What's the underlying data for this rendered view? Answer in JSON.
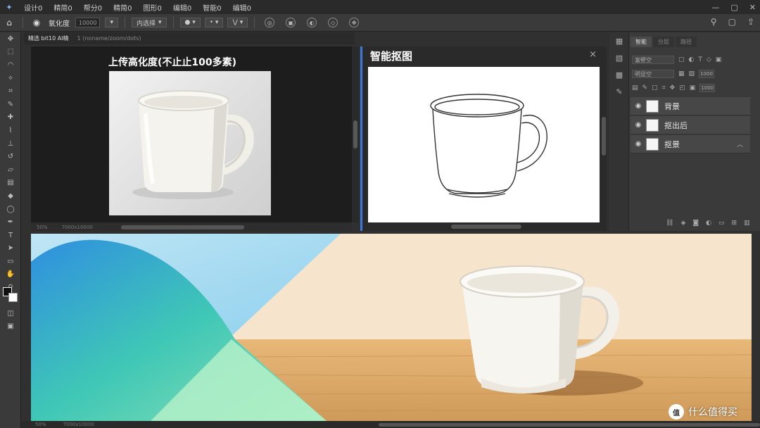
{
  "menubar": {
    "items": [
      "设计0",
      "精简0",
      "帮分0",
      "精简0",
      "图形0",
      "编辑0",
      "智能0",
      "编辑0"
    ]
  },
  "optbar": {
    "label1": "氧化度",
    "field1": "10000",
    "drop1": "内选择"
  },
  "doc_tab": {
    "name": "精选 bit10 AI精",
    "sub": "1 (noname/zoom/dots)"
  },
  "left_pane": {
    "title": "上传高化度(不止止100多素)",
    "status_a": "50%",
    "status_b": "7000x10000"
  },
  "right_pane": {
    "title": "智能抠图",
    "close": "×"
  },
  "right_panel": {
    "tabs": [
      "智能",
      "分层",
      "路径"
    ],
    "row1_select": "富壁空",
    "row2_select": "明显空",
    "row2_small": "1000",
    "row3_small": "1000",
    "layers": [
      {
        "label": "背景"
      },
      {
        "label": "抠出后"
      },
      {
        "label": "抠景"
      }
    ]
  },
  "status_bottom": {
    "a": "50%",
    "b": "7000x10000"
  },
  "watermark": {
    "logo": "值",
    "text": "什么值得买"
  },
  "colors": {
    "accent": "#3d78d8",
    "canvas_bg": "#1d1d1d",
    "panel_bg": "#3a3a3a"
  }
}
